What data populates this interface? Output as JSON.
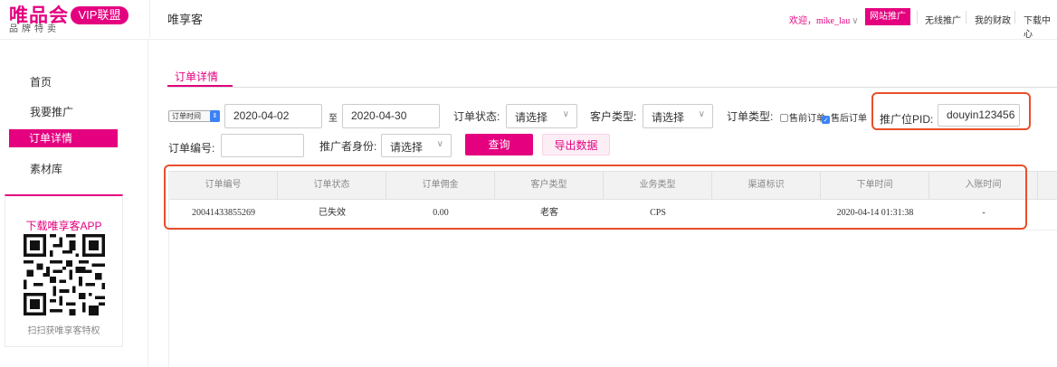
{
  "header": {
    "logo_main": "唯品会",
    "logo_sub": "品牌特卖",
    "vip_label": "VIP联盟",
    "app_title": "唯享客",
    "welcome": "欢迎，mike_lau",
    "welcome_caret": "∨",
    "nav": [
      "网站推广",
      "无线推广",
      "我的财政",
      "下载中心"
    ]
  },
  "sidebar": {
    "items": [
      "首页",
      "我要推广",
      "订单详情",
      "素材库"
    ],
    "active_index": 2,
    "promo_title": "下载唯享客APP",
    "promo_footer": "扫扫获唯享客特权"
  },
  "tab": {
    "label": "订单详情"
  },
  "filters": {
    "time_type": "订单时间",
    "date_from": "2020-04-02",
    "to_label": "至",
    "date_to": "2020-04-30",
    "order_status_label": "订单状态:",
    "order_status_value": "请选择",
    "customer_type_label": "客户类型:",
    "customer_type_value": "请选择",
    "order_type_label": "订单类型:",
    "order_type_pre": "售前订单",
    "order_type_post": "售后订单",
    "pid_label": "推广位PID:",
    "pid_value": "douyin123456",
    "order_no_label": "订单编号:",
    "order_no_value": "",
    "promoter_label": "推广者身份:",
    "promoter_value": "请选择",
    "search_btn": "查询",
    "export_btn": "导出数据",
    "select_arrow": "∨"
  },
  "table": {
    "columns": [
      "订单编号",
      "订单状态",
      "订单佣金",
      "客户类型",
      "业务类型",
      "渠道标识",
      "下单时间",
      "入账时间"
    ],
    "rows": [
      [
        "20041433855269",
        "已失效",
        "0.00",
        "老客",
        "CPS",
        "",
        "2020-04-14 01:31:38",
        "-"
      ]
    ]
  },
  "colors": {
    "brand": "#e4007f",
    "highlight": "#e8502a",
    "checkbox": "#3b82f6"
  }
}
